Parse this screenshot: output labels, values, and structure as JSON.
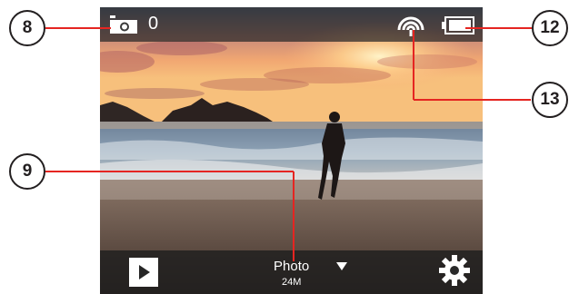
{
  "status_bar": {
    "shot_count": "0",
    "camera_icon": "photo-mode-icon",
    "wifi_icon": "wifi-icon",
    "battery_icon": "battery-icon"
  },
  "bottom_bar": {
    "play_icon": "play-icon",
    "mode_label": "Photo",
    "mode_dropdown_icon": "chevron-down-icon",
    "resolution": "24M",
    "settings_icon": "gear-icon"
  },
  "callouts": {
    "c8": "8",
    "c9": "9",
    "c12": "12",
    "c13": "13"
  },
  "colors": {
    "callout_line": "#e52521",
    "callout_border": "#231f20"
  }
}
